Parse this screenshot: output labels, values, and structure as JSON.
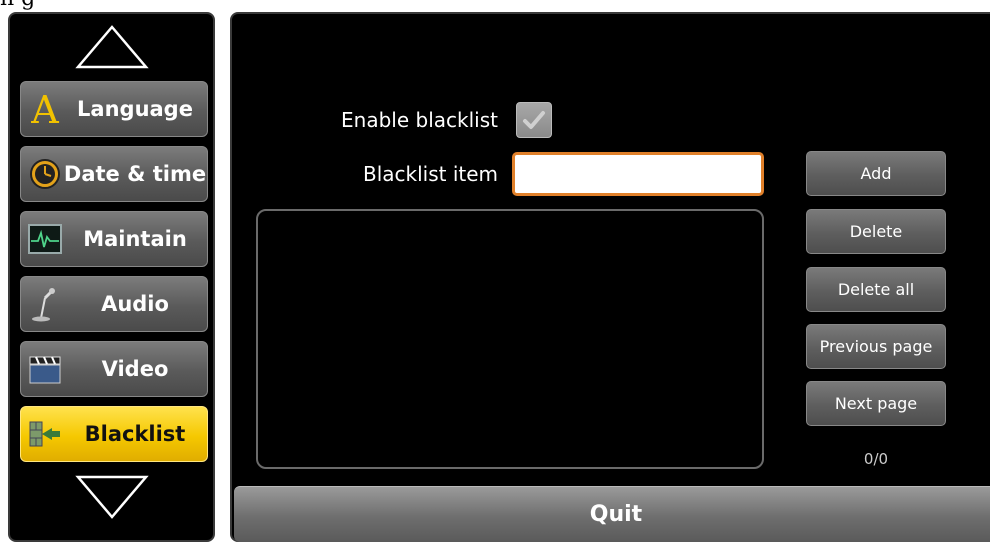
{
  "page": {
    "top_caption": "n g"
  },
  "sidebar": {
    "items": [
      {
        "label": "Language",
        "icon": "letter-a-icon"
      },
      {
        "label": "Date & time",
        "icon": "clock-icon"
      },
      {
        "label": "Maintain",
        "icon": "heartbeat-monitor-icon"
      },
      {
        "label": "Audio",
        "icon": "microphone-icon"
      },
      {
        "label": "Video",
        "icon": "clapperboard-icon"
      },
      {
        "label": "Blacklist",
        "icon": "blacklist-wall-icon",
        "active": true
      }
    ]
  },
  "main": {
    "enable_label": "Enable blacklist",
    "enable_checked": true,
    "item_label": "Blacklist item",
    "item_value": "",
    "buttons": {
      "add": "Add",
      "delete": "Delete",
      "delete_all": "Delete all",
      "previous": "Previous page",
      "next": "Next page"
    },
    "page_count": "0/0",
    "quit": "Quit"
  },
  "colors": {
    "active_nav": "#f5c800",
    "input_border": "#e0802a",
    "panel_bg": "#000000"
  }
}
